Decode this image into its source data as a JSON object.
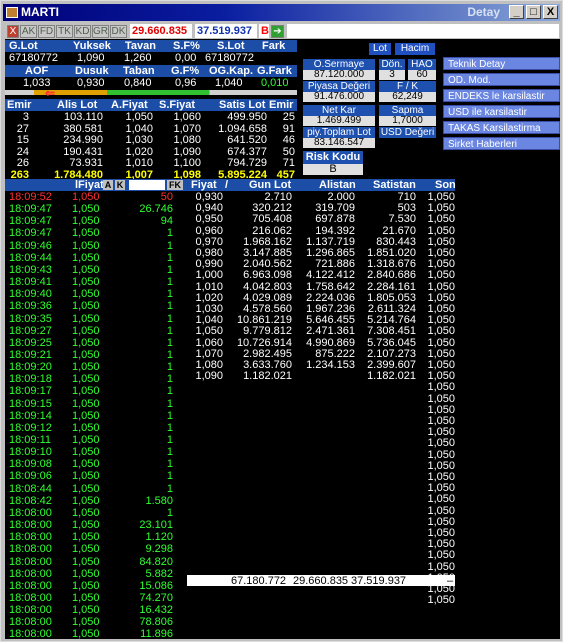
{
  "window": {
    "title": "MARTI",
    "subtitle": "Detay",
    "btn_min": "_",
    "btn_max": "□",
    "btn_close": "X"
  },
  "toolbar": {
    "buttons": [
      "X",
      "AK",
      "FD",
      "TK",
      "KD",
      "GR",
      "DK"
    ],
    "price_value": "29.660.835",
    "amount_value": "37.519.937",
    "b_label": "B",
    "arrow": "➔"
  },
  "summary": {
    "row1_headers": [
      "G.Lot",
      "Yuksek",
      "Tavan",
      "S.F%",
      "S.Lot",
      "Fark"
    ],
    "row1_values": [
      "67180772",
      "1,090",
      "1,260",
      "0,00",
      "67180772",
      ""
    ],
    "row2_headers": [
      "AOF",
      "Dusuk",
      "Taban",
      "G.F%",
      "OG.Kap.",
      "G.Fark"
    ],
    "row2_values": [
      "1,033",
      "0,930",
      "0,840",
      "0,96",
      "1,040",
      "0,010"
    ]
  },
  "depth": {
    "headers": [
      "Emir",
      "Alis Lot",
      "A.Fiyat",
      "S.Fiyat",
      "Satis Lot",
      "Emir"
    ],
    "rows": [
      [
        "3",
        "103.110",
        "1,050",
        "1,060",
        "499.950",
        "25"
      ],
      [
        "27",
        "380.581",
        "1,040",
        "1,070",
        "1.094.658",
        "91"
      ],
      [
        "15",
        "234.990",
        "1,030",
        "1,080",
        "641.520",
        "46"
      ],
      [
        "24",
        "190.431",
        "1,020",
        "1,090",
        "674.377",
        "50"
      ],
      [
        "26",
        "73.931",
        "1,010",
        "1,100",
        "794.729",
        "71"
      ]
    ],
    "totals": [
      "263",
      "1.784.480",
      "1,007",
      "1,098",
      "5.895.224",
      "457"
    ]
  },
  "info_panel": {
    "tab_lot": "Lot",
    "tab_hacim": "Hacim",
    "o_sermaye_label": "O.Sermaye",
    "o_sermaye_value": "87.120.000",
    "don_label": "Dön.",
    "don_value": "3",
    "hao_label": "HAO",
    "hao_value": "60",
    "piyasa_label": "Piyasa Değeri",
    "piyasa_value": "91.476.000",
    "fk_label": "F / K",
    "fk_value": "62,249",
    "netkar_label": "Net Kar",
    "netkar_value": "1.469.499",
    "sapma_label": "Sapma",
    "sapma_value": "1,7000",
    "toplam_label": "piy.Toplam Lot",
    "toplam_value": "83.146.547",
    "usd_label": "USD Değeri",
    "risk_label": "Risk Kodu",
    "risk_value": "B"
  },
  "menu": [
    "Teknik Detay",
    "OD. Mod.",
    "ENDEKS le karsilastir",
    "USD ile karsilastir",
    "TAKAS Karsilastirma",
    "Sirket Haberleri"
  ],
  "trades": {
    "headers": [
      "lFiyat",
      "A",
      "K",
      "",
      "FK"
    ],
    "rows": [
      [
        "18:09:52",
        "1,050",
        "50"
      ],
      [
        "18:09:47",
        "1,050",
        "26.746"
      ],
      [
        "18:09:47",
        "1,050",
        "94"
      ],
      [
        "18:09:47",
        "1,050",
        "1"
      ],
      [
        "18:09:46",
        "1,050",
        "1"
      ],
      [
        "18:09:44",
        "1,050",
        "1"
      ],
      [
        "18:09:43",
        "1,050",
        "1"
      ],
      [
        "18:09:41",
        "1,050",
        "1"
      ],
      [
        "18:09:40",
        "1,050",
        "1"
      ],
      [
        "18:09:36",
        "1,050",
        "1"
      ],
      [
        "18:09:35",
        "1,050",
        "1"
      ],
      [
        "18:09:27",
        "1,050",
        "1"
      ],
      [
        "18:09:25",
        "1,050",
        "1"
      ],
      [
        "18:09:21",
        "1,050",
        "1"
      ],
      [
        "18:09:20",
        "1,050",
        "1"
      ],
      [
        "18:09:18",
        "1,050",
        "1"
      ],
      [
        "18:09:17",
        "1,050",
        "1"
      ],
      [
        "18:09:15",
        "1,050",
        "1"
      ],
      [
        "18:09:14",
        "1,050",
        "1"
      ],
      [
        "18:09:12",
        "1,050",
        "1"
      ],
      [
        "18:09:11",
        "1,050",
        "1"
      ],
      [
        "18:09:10",
        "1,050",
        "1"
      ],
      [
        "18:09:08",
        "1,050",
        "1"
      ],
      [
        "18:09:06",
        "1,050",
        "1"
      ],
      [
        "18:08:44",
        "1,050",
        "1"
      ],
      [
        "18:08:42",
        "1,050",
        "1.580"
      ],
      [
        "18:08:00",
        "1,050",
        "1"
      ],
      [
        "18:08:00",
        "1,050",
        "23.101"
      ],
      [
        "18:08:00",
        "1,050",
        "1.120"
      ],
      [
        "18:08:00",
        "1,050",
        "9.298"
      ],
      [
        "18:08:00",
        "1,050",
        "84.820"
      ],
      [
        "18:08:00",
        "1,050",
        "5.882"
      ],
      [
        "18:08:00",
        "1,050",
        "15.086"
      ],
      [
        "18:08:00",
        "1,050",
        "74.270"
      ],
      [
        "18:08:00",
        "1,050",
        "16.432"
      ],
      [
        "18:08:00",
        "1,050",
        "78.806"
      ],
      [
        "18:08:00",
        "1,050",
        "11.896"
      ]
    ]
  },
  "price_dist": {
    "headers": [
      "Fiyat",
      "Gun Lot",
      "Alistan",
      "Satistan",
      "Son"
    ],
    "sort_indicator": "/",
    "rows": [
      [
        "0,930",
        "2.710",
        "2.000",
        "710",
        "1,050"
      ],
      [
        "0,940",
        "320.212",
        "319.709",
        "503",
        "1,050"
      ],
      [
        "0,950",
        "705.408",
        "697.878",
        "7.530",
        "1,050"
      ],
      [
        "0,960",
        "216.062",
        "194.392",
        "21.670",
        "1,050"
      ],
      [
        "0,970",
        "1.968.162",
        "1.137.719",
        "830.443",
        "1,050"
      ],
      [
        "0,980",
        "3.147.885",
        "1.296.865",
        "1.851.020",
        "1,050"
      ],
      [
        "0,990",
        "2.040.562",
        "721.886",
        "1.318.676",
        "1,050"
      ],
      [
        "1,000",
        "6.963.098",
        "4.122.412",
        "2.840.686",
        "1,050"
      ],
      [
        "1,010",
        "4.042.803",
        "1.758.642",
        "2.284.161",
        "1,050"
      ],
      [
        "1,020",
        "4.029.089",
        "2.224.036",
        "1.805.053",
        "1,050"
      ],
      [
        "1,030",
        "4.578.560",
        "1.967.236",
        "2.611.324",
        "1,050"
      ],
      [
        "1,040",
        "10.861.219",
        "5.646.455",
        "5.214.764",
        "1,050"
      ],
      [
        "1,050",
        "9.779.812",
        "2.471.361",
        "7.308.451",
        "1,050"
      ],
      [
        "1,060",
        "10.726.914",
        "4.990.869",
        "5.736.045",
        "1,050"
      ],
      [
        "1,070",
        "2.982.495",
        "875.222",
        "2.107.273",
        "1,050"
      ],
      [
        "1,080",
        "3.633.760",
        "1.234.153",
        "2.399.607",
        "1,050"
      ],
      [
        "1,090",
        "1.182.021",
        "",
        "1.182.021",
        "1,050"
      ]
    ],
    "son_extra": [
      "1,050",
      "1,050",
      "1,050",
      "1,050",
      "1,050",
      "1,050",
      "1,050",
      "1,050",
      "1,050",
      "1,050",
      "1,050",
      "1,050",
      "1,050",
      "1,050",
      "1,050",
      "1,050",
      "1,050",
      "1,050",
      "1,050",
      "1,050"
    ],
    "footer": {
      "total": "67.180.772",
      "alis": "29.660.835",
      "satis": "37.519.937",
      "marker": "–"
    }
  }
}
